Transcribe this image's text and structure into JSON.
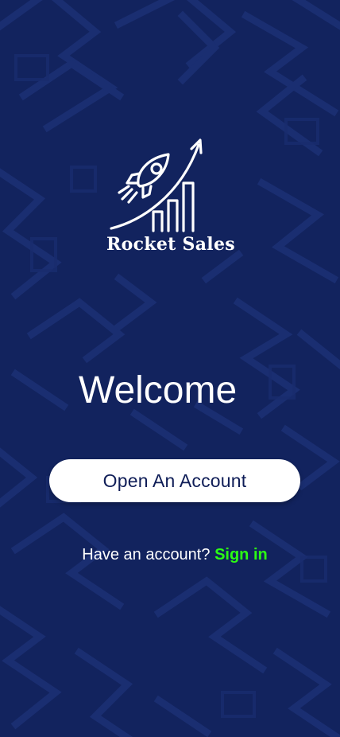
{
  "app": {
    "brand_name": "Rocket Sales",
    "logo_icon": "rocket-growth-chart-icon"
  },
  "welcome": {
    "title": "Welcome"
  },
  "actions": {
    "open_account_label": "Open An Account",
    "have_account_prompt": "Have an account?",
    "sign_in_label": "Sign in"
  },
  "colors": {
    "background": "#12235e",
    "pattern_line": "#1b2f72",
    "button_bg": "#ffffff",
    "button_text": "#0f1d57",
    "accent_link": "#2cff13",
    "text": "#ffffff"
  }
}
